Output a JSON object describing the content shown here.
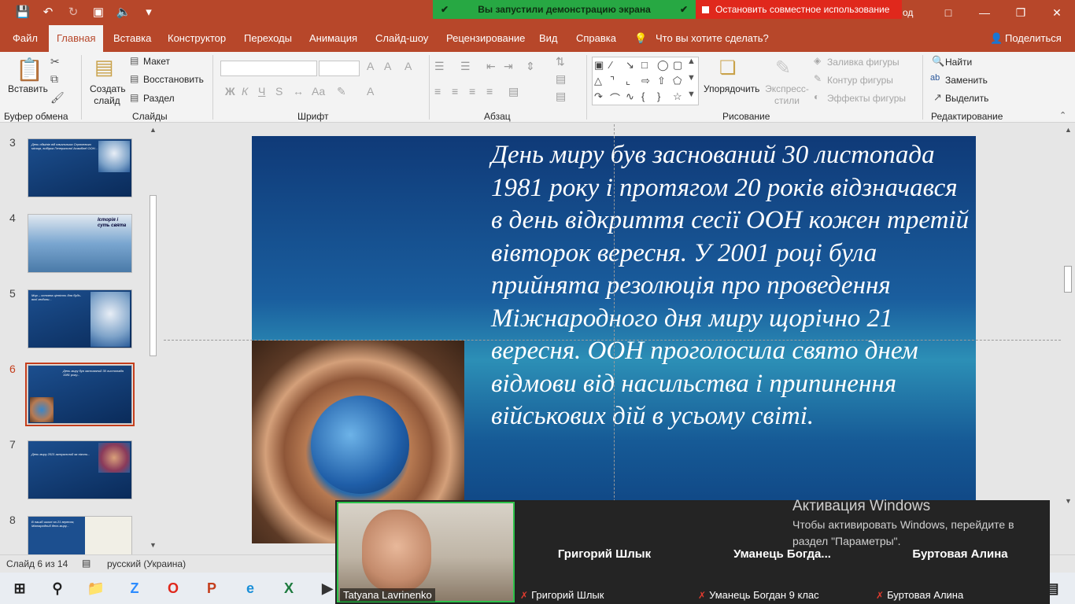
{
  "title_bar": {
    "quick_access": [
      "save-icon",
      "undo-icon",
      "redo-icon",
      "present-icon",
      "volume-icon",
      "customize-icon"
    ],
    "share_banner": {
      "running": "Вы запустили демонстрацию экрана",
      "stop": "Остановить совместное использование",
      "hidden_title": "од"
    }
  },
  "tabs": [
    {
      "label": "Файл"
    },
    {
      "label": "Главная",
      "active": true
    },
    {
      "label": "Вставка"
    },
    {
      "label": "Конструктор"
    },
    {
      "label": "Переходы"
    },
    {
      "label": "Анимация"
    },
    {
      "label": "Слайд-шоу"
    },
    {
      "label": "Рецензирование"
    },
    {
      "label": "Вид"
    },
    {
      "label": "Справка"
    },
    {
      "label": "Что вы хотите сделать?"
    }
  ],
  "share_label": "Поделиться",
  "ribbon": {
    "clipboard": {
      "paste": "Вставить",
      "label": "Буфер обмена"
    },
    "slides": {
      "new_slide": "Создать слайд",
      "layout": "Макет",
      "reset": "Восстановить",
      "section": "Раздел",
      "label": "Слайды"
    },
    "font": {
      "label": "Шрифт",
      "bold": "Ж",
      "italic": "К",
      "underline": "Ч"
    },
    "paragraph": {
      "label": "Абзац"
    },
    "drawing": {
      "arrange": "Упорядочить",
      "quick_styles": "Экспресс-стили",
      "fill": "Заливка фигуры",
      "outline": "Контур фигуры",
      "effects": "Эффекты фигуры",
      "label": "Рисование"
    },
    "editing": {
      "find": "Найти",
      "replace": "Заменить",
      "select": "Выделить",
      "label": "Редактирование"
    }
  },
  "thumbnails": [
    {
      "num": "3",
      "caption": "День обмінів від начальника Серпневого місяця, вибірка Генеральної Асамблеї ООН..."
    },
    {
      "num": "4",
      "caption": "Історія і суть свята"
    },
    {
      "num": "5",
      "caption": "Мир – основна цінність для будь-якої людини..."
    },
    {
      "num": "6",
      "caption": "День миру був заснований 30 листопада 1981 року...",
      "selected": true
    },
    {
      "num": "7",
      "caption": "День миру 2021 актуальний як ніколи..."
    },
    {
      "num": "8",
      "caption": "В нашій школі на 21 вересня, Міжнародний день миру..."
    }
  ],
  "slide": {
    "text": "День миру був заснований 30 листопада 1981 року і протягом 20 років відзначався в день відкриття сесії ООН кожен третій вівторок вересня. У 2001 році була прийнята резолюція про проведення Міжнародного дня миру щорічно 21 вересня. ООН проголосила свято днем відмови від насильства і припинення військових дій в усьому світі."
  },
  "status": {
    "slide_counter": "Слайд 6 из 14",
    "language": "русский (Украина)"
  },
  "video": {
    "self_name": "Tatyana Lavrinenko",
    "participants": [
      {
        "title": "Григорий Шлык",
        "label": "Григорий Шлык"
      },
      {
        "title": "Уманець Богда...",
        "label": "Уманець Богдан 9 клас"
      },
      {
        "title": "Буртовая Алина",
        "label": "Буртовая Алина"
      }
    ]
  },
  "activation": {
    "title": "Активация Windows",
    "line1": "Чтобы активировать Windows, перейдите в",
    "line2": "раздел \"Параметры\"."
  }
}
